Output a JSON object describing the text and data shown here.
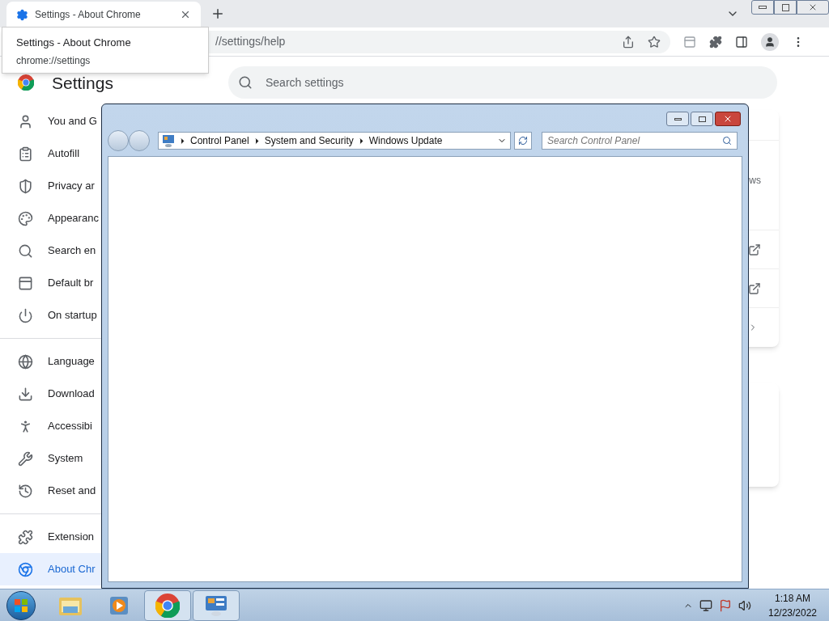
{
  "browser": {
    "tab": {
      "title": "Settings - About Chrome",
      "selected": true
    },
    "tooltip": {
      "title": "Settings - About Chrome",
      "url": "chrome://settings"
    },
    "address": "//settings/help"
  },
  "settings": {
    "title": "Settings",
    "search": {
      "placeholder": "Search settings"
    },
    "nav": [
      [
        {
          "label": "You and G",
          "selected": false
        },
        {
          "label": "Autofill",
          "selected": false
        },
        {
          "label": "Privacy ar",
          "selected": false
        },
        {
          "label": "Appearanc",
          "selected": false
        },
        {
          "label": "Search en",
          "selected": false
        },
        {
          "label": "Default br",
          "selected": false
        },
        {
          "label": "On startup",
          "selected": false
        }
      ],
      [
        {
          "label": "Language",
          "selected": false
        },
        {
          "label": "Download",
          "selected": false
        },
        {
          "label": "Accessibi",
          "selected": false
        },
        {
          "label": "System",
          "selected": false
        },
        {
          "label": "Reset and",
          "selected": false
        }
      ],
      [
        {
          "label": "Extension",
          "selected": false
        },
        {
          "label": "About Chr",
          "selected": true
        }
      ]
    ],
    "card_text": "ws"
  },
  "control_panel": {
    "breadcrumb": [
      "Control Panel",
      "System and Security",
      "Windows Update"
    ],
    "search": {
      "placeholder": "Search Control Panel"
    }
  },
  "taskbar": {
    "apps": [
      {
        "selected": false
      },
      {
        "selected": false
      },
      {
        "selected": true
      },
      {
        "selected": true
      }
    ],
    "clock": {
      "time": "1:18 AM",
      "date": "12/23/2022"
    }
  }
}
